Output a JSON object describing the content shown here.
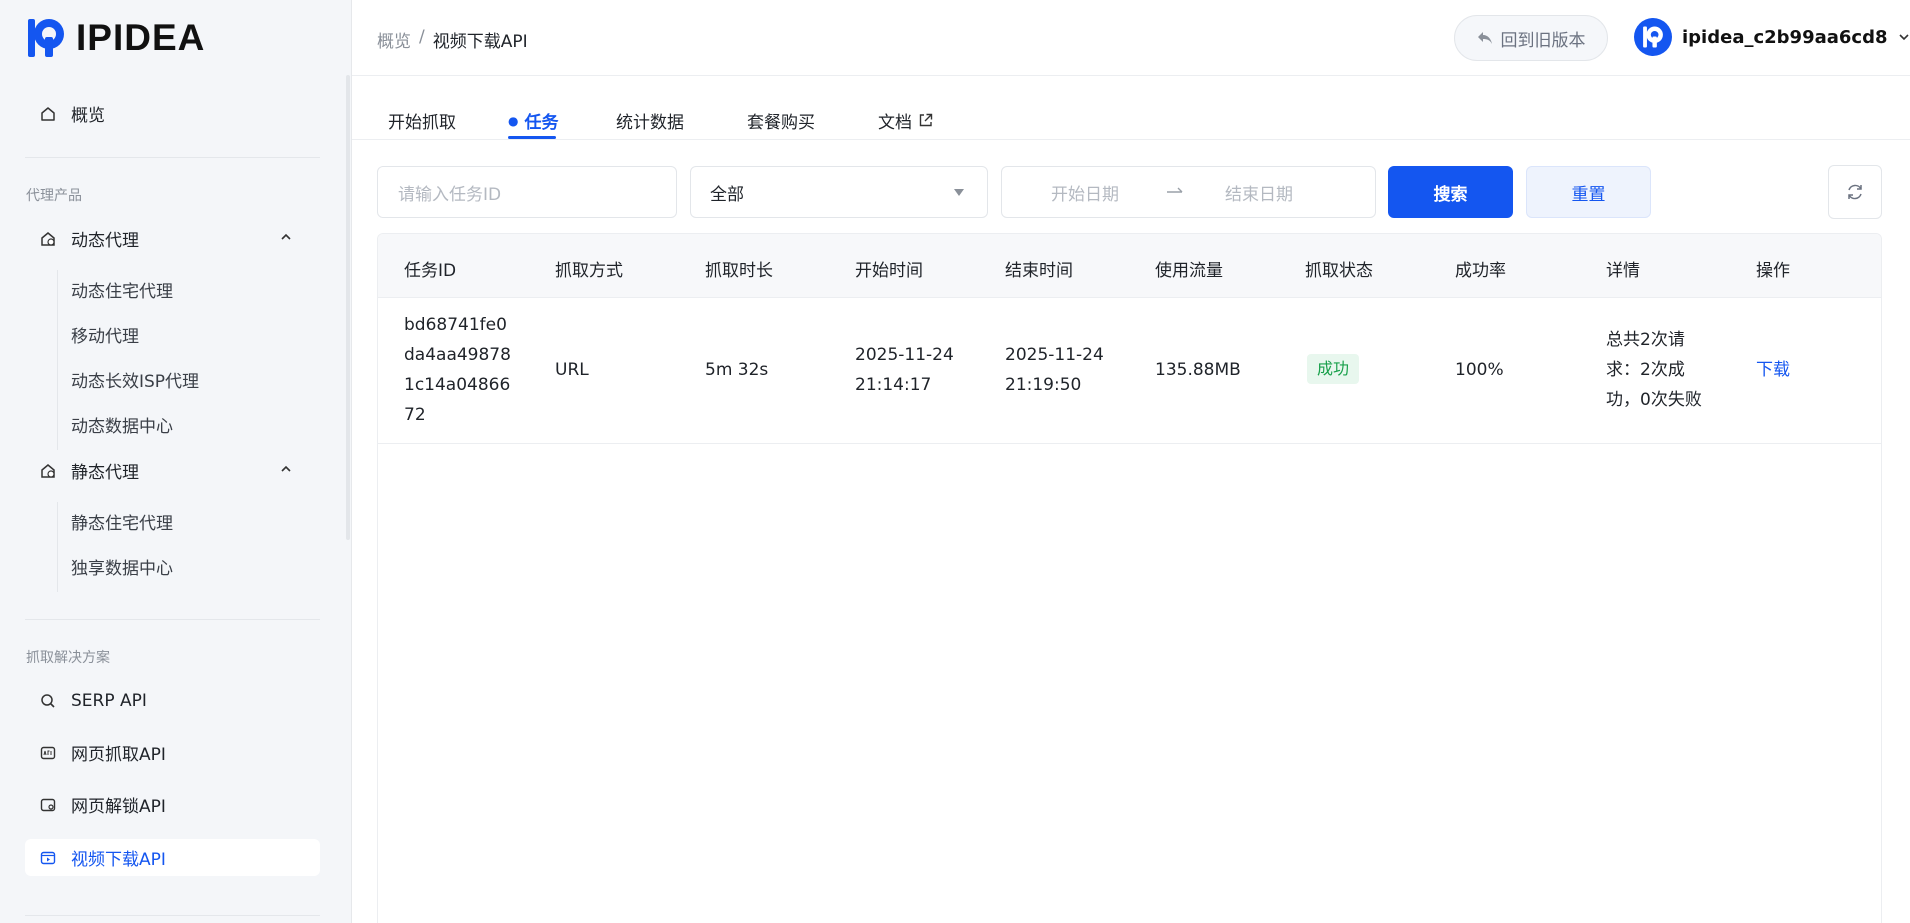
{
  "brand": {
    "name": "IPIDEA",
    "color": "#1456f0"
  },
  "sidebar": {
    "overview": "概览",
    "section_proxy": "代理产品",
    "dynamic_proxy": {
      "label": "动态代理",
      "items": [
        "动态住宅代理",
        "移动代理",
        "动态长效ISP代理",
        "动态数据中心"
      ]
    },
    "static_proxy": {
      "label": "静态代理",
      "items": [
        "静态住宅代理",
        "独享数据中心"
      ]
    },
    "section_scrape": "抓取解决方案",
    "scrape_items": [
      "SERP API",
      "网页抓取API",
      "网页解锁API",
      "视频下载API"
    ]
  },
  "header": {
    "breadcrumb_home": "概览",
    "breadcrumb_sep": "/",
    "breadcrumb_current": "视频下载API",
    "old_version": "回到旧版本",
    "username": "ipidea_c2b99aa6cd8"
  },
  "tabs": [
    "开始抓取",
    "任务",
    "统计数据",
    "套餐购买",
    "文档"
  ],
  "filters": {
    "task_id_placeholder": "请输入任务ID",
    "status_select": "全部",
    "start_date_placeholder": "开始日期",
    "end_date_placeholder": "结束日期",
    "search": "搜索",
    "reset": "重置"
  },
  "table": {
    "headers": [
      "任务ID",
      "抓取方式",
      "抓取时长",
      "开始时间",
      "结束时间",
      "使用流量",
      "抓取状态",
      "成功率",
      "详情",
      "操作"
    ],
    "rows": [
      {
        "task_id_lines": [
          "bd68741fe0",
          "da4aa49878",
          "1c14a04866",
          "72"
        ],
        "method": "URL",
        "duration": "5m 32s",
        "start": [
          "2025-11-24",
          "21:14:17"
        ],
        "end": [
          "2025-11-24",
          "21:19:50"
        ],
        "traffic": "135.88MB",
        "status": "成功",
        "success_rate": "100%",
        "detail_lines": [
          "总共2次请",
          "求：2次成",
          "功，0次失败"
        ],
        "action": "下载"
      }
    ]
  }
}
